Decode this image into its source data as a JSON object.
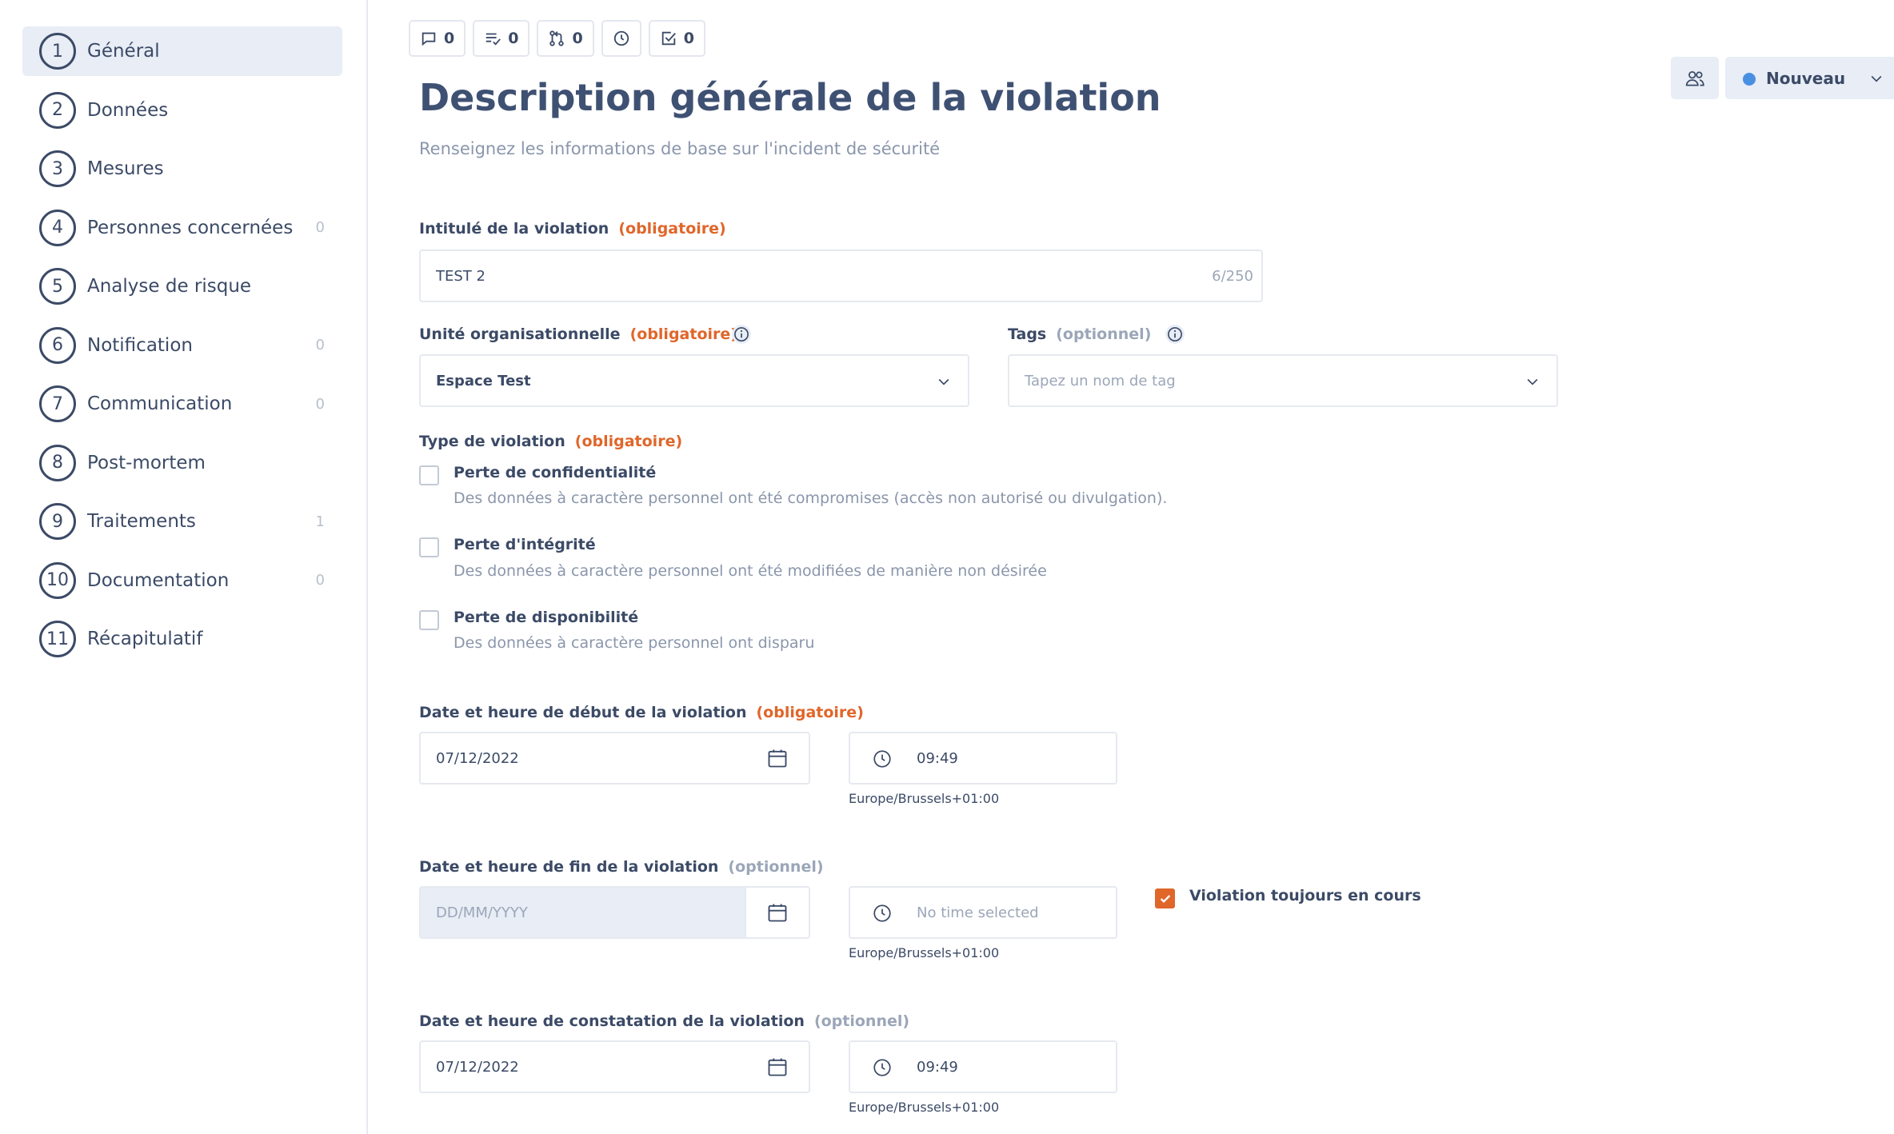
{
  "sidebar": {
    "items": [
      {
        "num": "1",
        "label": "Général",
        "count": ""
      },
      {
        "num": "2",
        "label": "Données",
        "count": ""
      },
      {
        "num": "3",
        "label": "Mesures",
        "count": ""
      },
      {
        "num": "4",
        "label": "Personnes concernées",
        "count": "0"
      },
      {
        "num": "5",
        "label": "Analyse de risque",
        "count": ""
      },
      {
        "num": "6",
        "label": "Notification",
        "count": "0"
      },
      {
        "num": "7",
        "label": "Communication",
        "count": "0"
      },
      {
        "num": "8",
        "label": "Post-mortem",
        "count": ""
      },
      {
        "num": "9",
        "label": "Traitements",
        "count": "1"
      },
      {
        "num": "10",
        "label": "Documentation",
        "count": "0"
      },
      {
        "num": "11",
        "label": "Récapitulatif",
        "count": ""
      }
    ]
  },
  "toolbar": {
    "comments": "0",
    "tasks": "0",
    "changes": "0",
    "checks": "0"
  },
  "status": {
    "label": "Nouveau",
    "color": "#4a90e2"
  },
  "header": {
    "title": "Description générale de la violation",
    "subtitle": "Renseignez les informations de base sur l'incident de sécurité"
  },
  "labels": {
    "required": "(obligatoire)",
    "optional": "(optionnel)"
  },
  "form": {
    "title_field": {
      "label": "Intitulé de la violation",
      "value": "TEST 2",
      "counter": "6/250"
    },
    "org_unit": {
      "label": "Unité organisationnelle",
      "value": "Espace Test"
    },
    "tags": {
      "label": "Tags",
      "placeholder": "Tapez un nom de tag"
    },
    "violation_type": {
      "label": "Type de violation",
      "options": [
        {
          "title": "Perte de confidentialité",
          "desc": "Des données à caractère personnel ont été compromises (accès non autorisé ou divulgation).",
          "checked": false
        },
        {
          "title": "Perte d'intégrité",
          "desc": "Des données à caractère personnel ont été modifiées de manière non désirée",
          "checked": false
        },
        {
          "title": "Perte de disponibilité",
          "desc": "Des données à caractère personnel ont disparu",
          "checked": false
        }
      ]
    },
    "start": {
      "label": "Date et heure de début de la violation",
      "date": "07/12/2022",
      "time": "09:49",
      "tz": "Europe/Brussels+01:00"
    },
    "end": {
      "label": "Date et heure de fin de la violation",
      "date_placeholder": "DD/MM/YYYY",
      "time_placeholder": "No time selected",
      "tz": "Europe/Brussels+01:00",
      "ongoing_label": "Violation toujours en cours",
      "ongoing_checked": true
    },
    "detection": {
      "label": "Date et heure de constatation de la violation",
      "date": "07/12/2022",
      "time": "09:49",
      "tz": "Europe/Brussels+01:00"
    }
  },
  "colors": {
    "accent": "#e0662a",
    "text": "#3b4a66",
    "muted": "#8a96ab",
    "active_bg": "#e8edf6"
  }
}
